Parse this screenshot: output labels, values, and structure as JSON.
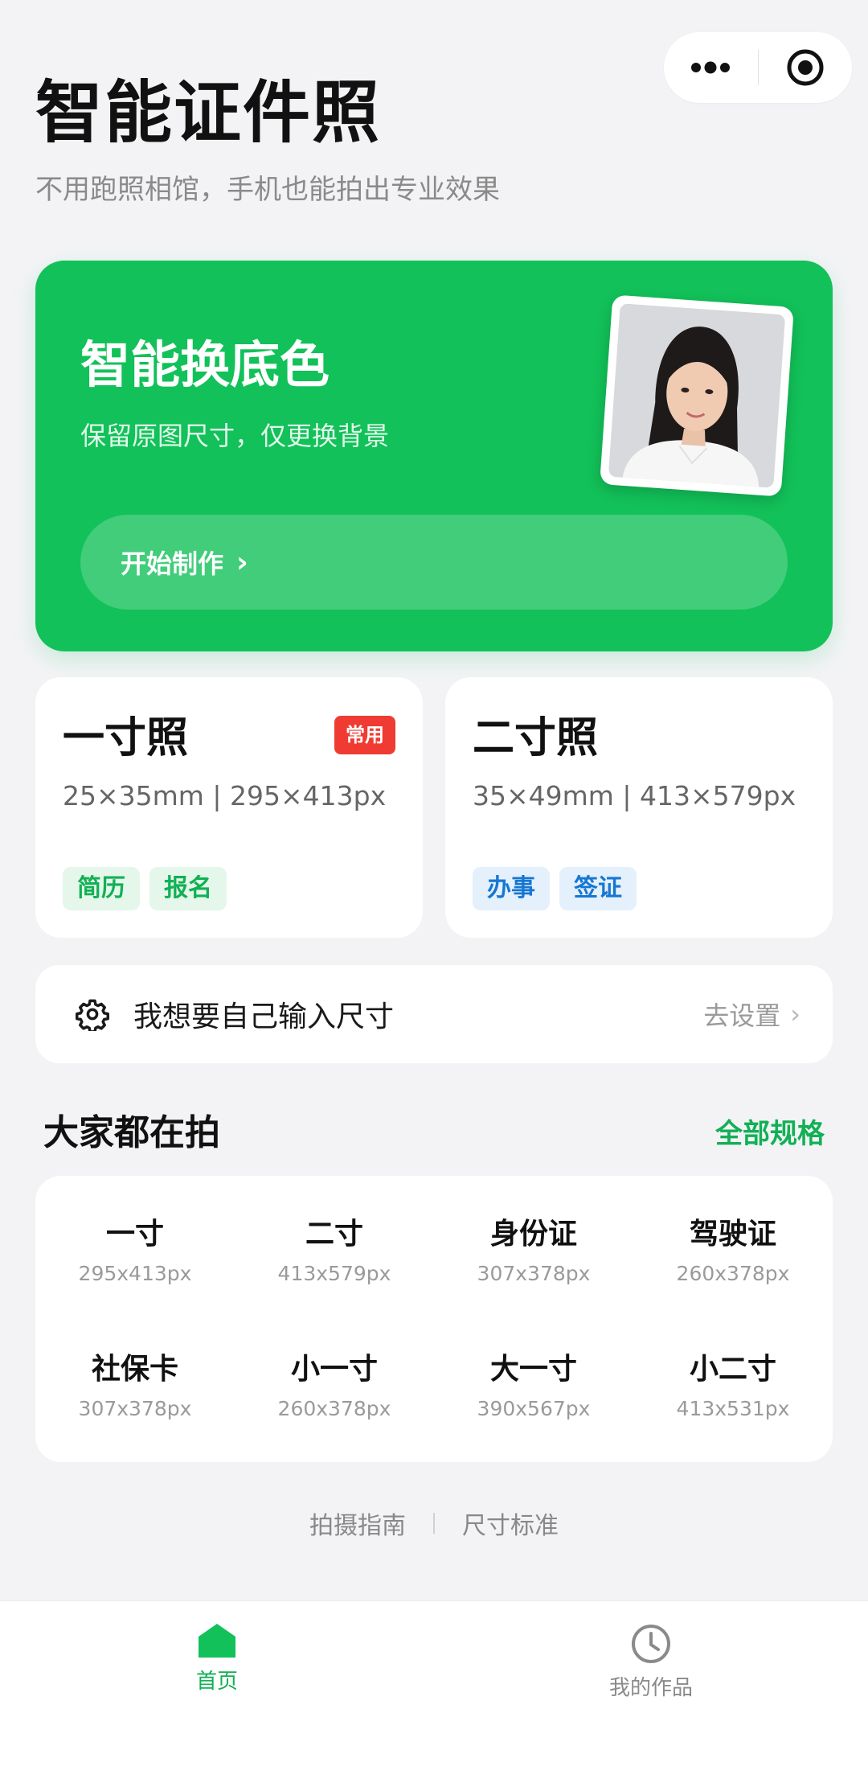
{
  "header": {
    "title": "智能证件照",
    "subtitle": "不用跑照相馆，手机也能拍出专业效果",
    "capsule": {
      "more_icon": "more-dots-icon",
      "close_icon": "target-icon"
    }
  },
  "hero": {
    "title": "智能换底色",
    "subtitle": "保留原图尺寸，仅更换背景",
    "button_label": "开始制作",
    "accent": "#12c159"
  },
  "size_cards": [
    {
      "title": "一寸照",
      "spec": "25×35mm | 295×413px",
      "badge": "常用",
      "tags": [
        "简历",
        "报名"
      ]
    },
    {
      "title": "二寸照",
      "spec": "35×49mm | 413×579px",
      "tags": [
        "办事",
        "签证"
      ]
    }
  ],
  "custom_size": {
    "label": "我想要自己输入尺寸",
    "action": "去设置"
  },
  "popular": {
    "title": "大家都在拍",
    "link": "全部规格",
    "items": [
      {
        "name": "一寸",
        "px": "295x413px"
      },
      {
        "name": "二寸",
        "px": "413x579px"
      },
      {
        "name": "身份证",
        "px": "307x378px"
      },
      {
        "name": "驾驶证",
        "px": "260x378px"
      },
      {
        "name": "社保卡",
        "px": "307x378px"
      },
      {
        "name": "小一寸",
        "px": "260x378px"
      },
      {
        "name": "大一寸",
        "px": "390x567px"
      },
      {
        "name": "小二寸",
        "px": "413x531px"
      }
    ]
  },
  "footer_links": [
    "拍摄指南",
    "尺寸标准"
  ],
  "tabbar": {
    "tabs": [
      {
        "label": "首页",
        "icon": "home-icon",
        "active": true
      },
      {
        "label": "我的作品",
        "icon": "clock-icon",
        "active": false
      }
    ]
  },
  "colors": {
    "accent": "#12c159",
    "badge": "#ef3b32",
    "background": "#f3f3f6"
  }
}
